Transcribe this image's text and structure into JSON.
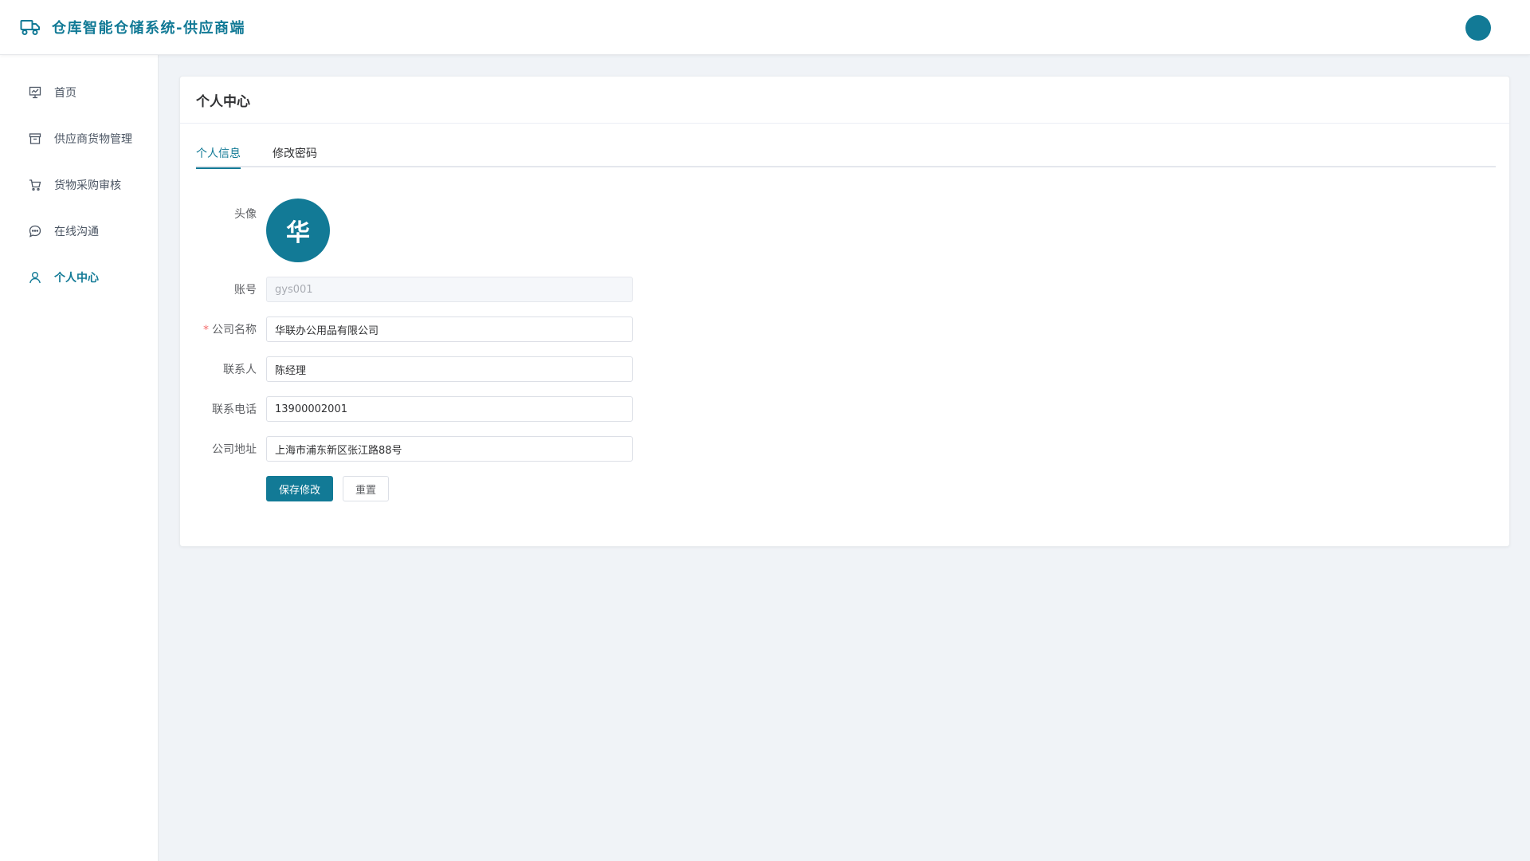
{
  "header": {
    "title": "仓库智能仓储系统-供应商端",
    "brand_icon": "truck-icon",
    "accent_color": "#127a96"
  },
  "sidebar": {
    "items": [
      {
        "label": "首页",
        "icon": "chart-board-icon",
        "active": false
      },
      {
        "label": "供应商货物管理",
        "icon": "archive-box-icon",
        "active": false
      },
      {
        "label": "货物采购审核",
        "icon": "shopping-cart-icon",
        "active": false
      },
      {
        "label": "在线沟通",
        "icon": "chat-bubble-icon",
        "active": false
      },
      {
        "label": "个人中心",
        "icon": "user-icon",
        "active": true
      }
    ]
  },
  "card": {
    "title": "个人中心",
    "tabs": [
      {
        "label": "个人信息",
        "active": true
      },
      {
        "label": "修改密码",
        "active": false
      }
    ]
  },
  "form": {
    "avatar_label": "头像",
    "avatar_text": "华",
    "account": {
      "label": "账号",
      "value": "gys001"
    },
    "company": {
      "label": "公司名称",
      "value": "华联办公用品有限公司",
      "required_mark": "*"
    },
    "contact": {
      "label": "联系人",
      "value": "陈经理"
    },
    "phone": {
      "label": "联系电话",
      "value": "13900002001"
    },
    "address": {
      "label": "公司地址",
      "value": "上海市浦东新区张江路88号"
    },
    "save_label": "保存修改",
    "reset_label": "重置"
  }
}
